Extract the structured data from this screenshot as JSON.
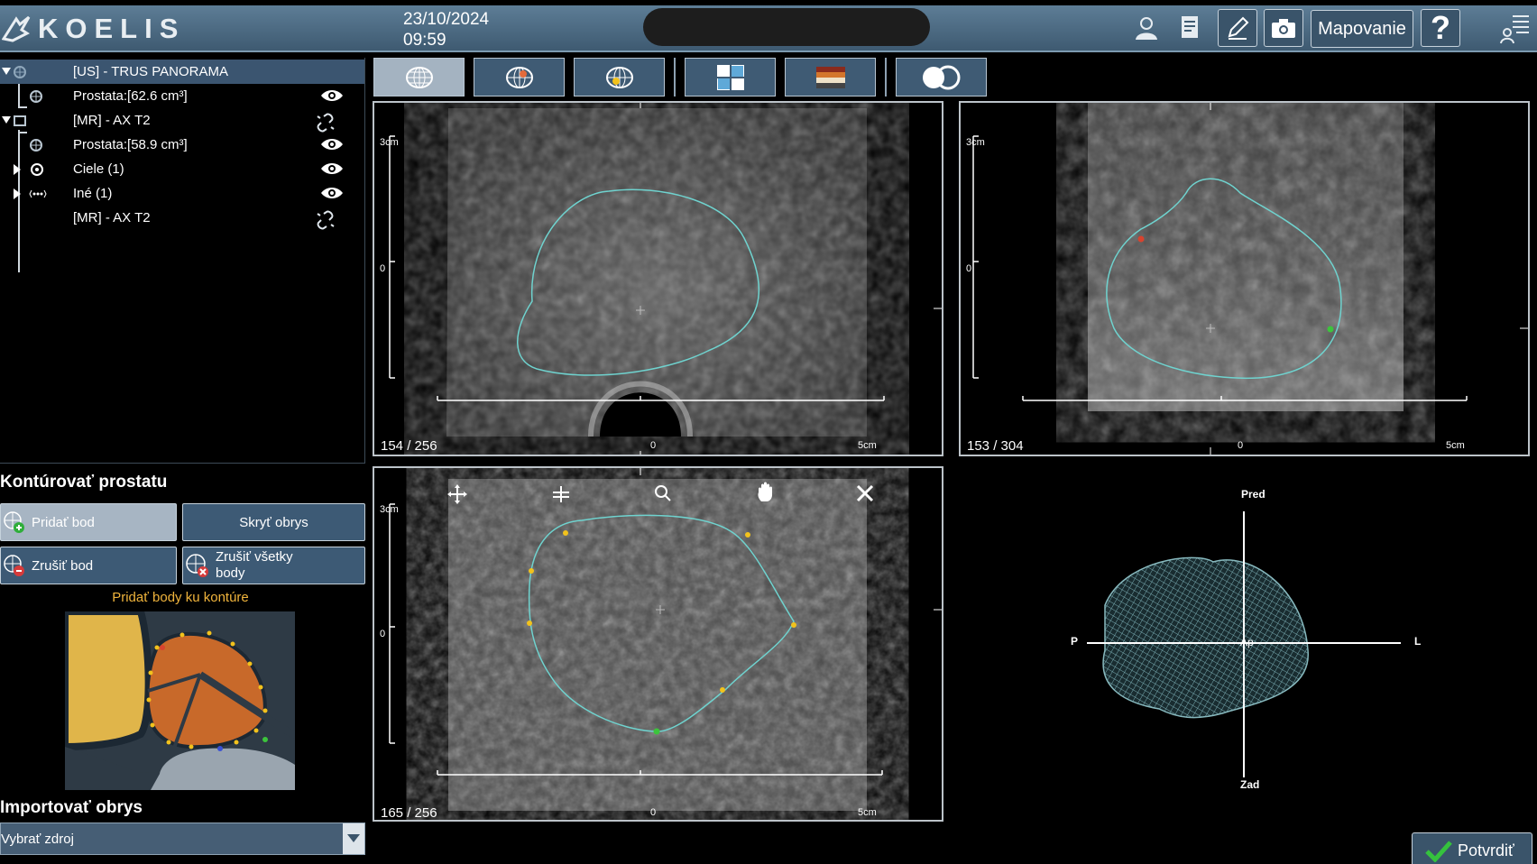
{
  "header": {
    "brand": "KOELIS",
    "date": "23/10/2024",
    "time": "09:59",
    "mapping_label": "Mapovanie",
    "help_label": "?"
  },
  "tree": {
    "items": [
      {
        "label": "[US] - TRUS PANORAMA",
        "icon": "us-volume-icon",
        "status": "none"
      },
      {
        "label": "Prostata:[62.6 cm³]",
        "icon": "mesh-icon",
        "status": "eye"
      },
      {
        "label": "[MR] - AX T2",
        "icon": "mr-volume-icon",
        "status": "link"
      },
      {
        "label": "Prostata:[58.9 cm³]",
        "icon": "mesh-icon",
        "status": "eye"
      },
      {
        "label": "Ciele (1)",
        "icon": "target-icon",
        "status": "eye"
      },
      {
        "label": "Iné (1)",
        "icon": "dots-icon",
        "status": "eye"
      },
      {
        "label": "[MR] - AX T2",
        "icon": "",
        "status": "link"
      }
    ]
  },
  "toolbar": {
    "buttons": [
      "globe-grid-icon",
      "globe-color-icon",
      "globe-yellow-icon",
      "layout-icon",
      "colormap-icon",
      "fusion-icon"
    ]
  },
  "viewports": {
    "axial_us": {
      "slice": "154 / 256",
      "scale_top": "3cm",
      "scale_mid": "0",
      "scale_x0": "0",
      "scale_x5": "5cm"
    },
    "sagittal_us": {
      "slice": "153 / 304",
      "scale_top": "3cm",
      "scale_mid": "0",
      "scale_x0": "0",
      "scale_x5": "5cm"
    },
    "axial_mr": {
      "slice": "165 / 256",
      "scale_top": "3cm",
      "scale_mid": "0",
      "scale_x0": "0",
      "scale_x5": "5cm"
    },
    "model3d": {
      "front": "Pred",
      "back": "Zad",
      "left": "L",
      "right": "P",
      "center": "Ap"
    }
  },
  "contour": {
    "title": "Kontúrovať prostatu",
    "add_point": "Pridať bod",
    "hide_outline": "Skryť obrys",
    "delete_point": "Zrušiť bod",
    "delete_all": "Zrušiť všetky body",
    "hint": "Pridať body ku kontúre"
  },
  "import": {
    "title": "Importovať obrys",
    "select_value": "Vybrať zdroj"
  },
  "confirm_label": "Potvrdiť",
  "colors": {
    "header": "#4a677f",
    "contour": "#6fd3cf",
    "point_yellow": "#f2c21c",
    "point_red": "#d8432e",
    "point_green": "#3cc43c",
    "prostate_diagram": "#c8692a",
    "bladder_diagram": "#e0b54a"
  }
}
